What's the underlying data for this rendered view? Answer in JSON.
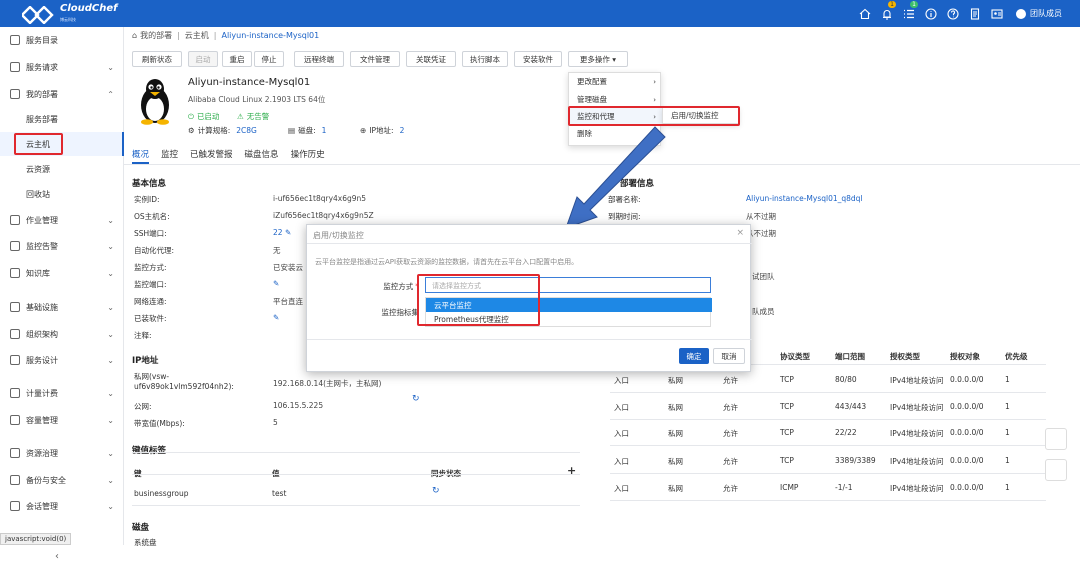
{
  "header": {
    "brand": "CloudChef",
    "brand_sub": "博云科技",
    "notify_badge": "1",
    "tasks_badge": "1",
    "user_name": "团队成员"
  },
  "sidebar": {
    "items": [
      {
        "label": "服务目录"
      },
      {
        "label": "服务请求"
      },
      {
        "label": "我的部署"
      },
      {
        "label": "作业管理"
      },
      {
        "label": "监控告警"
      },
      {
        "label": "知识库"
      },
      {
        "label": "基础设施"
      },
      {
        "label": "组织架构"
      },
      {
        "label": "服务设计"
      },
      {
        "label": "计量计费"
      },
      {
        "label": "容量管理"
      },
      {
        "label": "资源治理"
      },
      {
        "label": "备份与安全"
      },
      {
        "label": "会话管理"
      }
    ],
    "sub_items": [
      "服务部署",
      "云主机",
      "云资源",
      "回收站"
    ],
    "status_text": "javascript:void(0)"
  },
  "breadcrumb": [
    "我的部署",
    "云主机",
    "Aliyun-instance-Mysql01"
  ],
  "toolbar": {
    "refresh": "刷新状态",
    "start": "启动",
    "restart": "重启",
    "stop": "停止",
    "remote": "远程终端",
    "files": "文件管理",
    "credential": "关联凭证",
    "script": "执行脚本",
    "install": "安装软件",
    "more": "更多操作 ▾"
  },
  "instance": {
    "name": "Aliyun-instance-Mysql01",
    "os": "Alibaba Cloud Linux 2.1903 LTS 64位",
    "status": "已启动",
    "alarm": "无告警",
    "spec_label": "计算规格:",
    "spec_value": "2C8G",
    "disk_label": "磁盘:",
    "disk_value": "1",
    "ip_label": "IP地址:",
    "ip_value": "2"
  },
  "tabs": [
    "概况",
    "监控",
    "已触发警报",
    "磁盘信息",
    "操作历史"
  ],
  "basic_info": {
    "title": "基本信息",
    "rows": [
      {
        "k": "实例ID:",
        "v": "i-uf656ec1t8qry4x6g9n5"
      },
      {
        "k": "OS主机名:",
        "v": "iZuf656ec1t8qry4x6g9n5Z"
      },
      {
        "k": "SSH端口:",
        "v": "22"
      },
      {
        "k": "自动化代理:",
        "v": "无"
      },
      {
        "k": "监控方式:",
        "v": "已安装云"
      },
      {
        "k": "监控端口:",
        "v": ""
      },
      {
        "k": "网络连通:",
        "v": "平台直连"
      },
      {
        "k": "已装软件:",
        "v": ""
      },
      {
        "k": "注释:",
        "v": ""
      }
    ]
  },
  "deploy_info": {
    "title": "部署信息",
    "rows": [
      {
        "k": "部署名称:",
        "v": "Aliyun-instance-Mysql01_q8dql"
      },
      {
        "k": "到期时间:",
        "v": "从不过期"
      },
      {
        "k": "",
        "v": "从不过期"
      }
    ],
    "group_partial": "试团队",
    "owner_partial": "队成员"
  },
  "more_menu": {
    "items": [
      "更改配置",
      "管理磁盘",
      "监控和代理",
      "删除"
    ],
    "submenu": "启用/切换监控"
  },
  "modal": {
    "title": "启用/切换监控",
    "close": "×",
    "desc": "云平台监控是指通过云API获取云资源的监控数据，请首先在云平台入口配置中启用。",
    "method_label": "监控方式",
    "method_placeholder": "请选择监控方式",
    "metrics_label": "监控指标集",
    "options": [
      "云平台监控",
      "Prometheus代理监控"
    ],
    "ok": "确定",
    "cancel": "取消"
  },
  "ip_section": {
    "title": "IP地址",
    "private_label": "私网(vsw-uf6v89ok1vlm592f04nh2):",
    "private_value": "192.168.0.14(主网卡，主私网)",
    "public_label": "公网:",
    "public_value": "106.15.5.225",
    "bandwidth_label": "带宽值(Mbps):",
    "bandwidth_value": "5"
  },
  "tag_section": {
    "title": "键值标签",
    "col_key": "键",
    "col_value": "值",
    "col_sync": "同步状态",
    "add": "+",
    "rows": [
      {
        "k": "businessgroup",
        "v": "test"
      }
    ]
  },
  "disk_section": {
    "title": "磁盘",
    "sub": "系统盘"
  },
  "security_table": {
    "headers": [
      "协议类型",
      "端口范围",
      "授权类型",
      "授权对象",
      "优先级"
    ],
    "rows": [
      [
        "入口",
        "私网",
        "允许",
        "TCP",
        "80/80",
        "IPv4地址段访问",
        "0.0.0.0/0",
        "1"
      ],
      [
        "入口",
        "私网",
        "允许",
        "TCP",
        "443/443",
        "IPv4地址段访问",
        "0.0.0.0/0",
        "1"
      ],
      [
        "入口",
        "私网",
        "允许",
        "TCP",
        "22/22",
        "IPv4地址段访问",
        "0.0.0.0/0",
        "1"
      ],
      [
        "入口",
        "私网",
        "允许",
        "TCP",
        "3389/3389",
        "IPv4地址段访问",
        "0.0.0.0/0",
        "1"
      ],
      [
        "入口",
        "私网",
        "允许",
        "ICMP",
        "-1/-1",
        "IPv4地址段访问",
        "0.0.0.0/0",
        "1"
      ]
    ]
  },
  "colors": {
    "brand": "#1b62c6",
    "highlight": "#e0282e",
    "success": "#2fae4d"
  }
}
